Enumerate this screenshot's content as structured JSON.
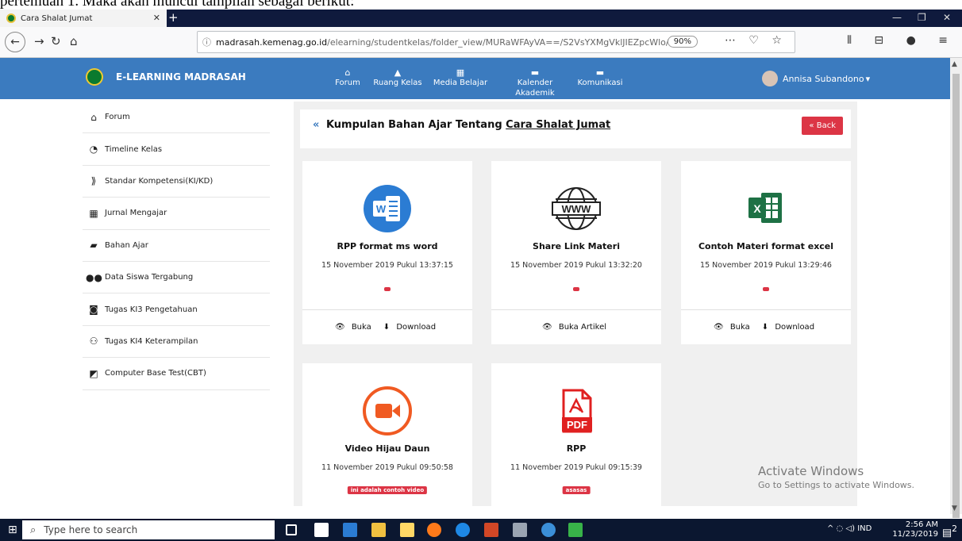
{
  "doc_caption": "pertemuan 1. Maka akan muncul tampilan sebagai berikut:",
  "browser": {
    "tab_title": "Cara Shalat Jumat",
    "url_domain": "madrasah.kemenag.go.id",
    "url_path": "/elearning/studentkelas/folder_view/MURaWFAyVA==/S2VsYXMgVklJIEZpcWlo/",
    "zoom": "90%"
  },
  "app": {
    "brand": "E-LEARNING MADRASAH",
    "nav": [
      {
        "label": "Forum",
        "icon": "home-icon"
      },
      {
        "label": "Ruang Kelas",
        "icon": "class-icon"
      },
      {
        "label": "Media Belajar",
        "icon": "media-icon"
      },
      {
        "label": "Kalender Akademik",
        "icon": "calendar-icon"
      },
      {
        "label": "Komunikasi",
        "icon": "chat-icon"
      }
    ],
    "user": "Annisa Subandono"
  },
  "sidebar": {
    "items": [
      {
        "label": "Forum",
        "icon": "home-icon"
      },
      {
        "label": "Timeline Kelas",
        "icon": "timeline-icon"
      },
      {
        "label": "Standar Kompetensi(KI/KD)",
        "icon": "standard-icon"
      },
      {
        "label": "Jurnal Mengajar",
        "icon": "calendar-icon"
      },
      {
        "label": "Bahan Ajar",
        "icon": "folder-icon"
      },
      {
        "label": "Data Siswa Tergabung",
        "icon": "users-icon"
      },
      {
        "label": "Tugas KI3 Pengetahuan",
        "icon": "task-icon"
      },
      {
        "label": "Tugas KI4 Keterampilan",
        "icon": "skill-icon"
      },
      {
        "label": "Computer Base Test(CBT)",
        "icon": "cbt-icon"
      }
    ]
  },
  "header": {
    "prefix": "Kumpulan Bahan Ajar Tentang",
    "topic": "Cara Shalat Jumat",
    "back": "Back"
  },
  "cards": [
    {
      "title": "RPP format ms word",
      "date": "15 November 2019 Pukul 13:37:15",
      "icon": "word-icon",
      "badge": "",
      "actions": [
        "Buka",
        "Download"
      ]
    },
    {
      "title": "Share Link Materi",
      "date": "15 November 2019 Pukul 13:32:20",
      "icon": "www-icon",
      "badge": "",
      "actions": [
        "Buka Artikel"
      ]
    },
    {
      "title": "Contoh Materi format excel",
      "date": "15 November 2019 Pukul 13:29:46",
      "icon": "excel-icon",
      "badge": "",
      "actions": [
        "Buka",
        "Download"
      ]
    },
    {
      "title": "Video Hijau Daun",
      "date": "11 November 2019 Pukul 09:50:58",
      "icon": "video-icon",
      "badge": "ini adalah contoh video",
      "actions": []
    },
    {
      "title": "RPP",
      "date": "11 November 2019 Pukul 09:15:39",
      "icon": "pdf-icon",
      "badge": "asasas",
      "actions": []
    }
  ],
  "watermark": {
    "line1": "Activate Windows",
    "line2": "Go to Settings to activate Windows."
  },
  "taskbar": {
    "search_placeholder": "Type here to search",
    "time": "2:56 AM",
    "date": "11/23/2019",
    "lang": "IND",
    "notif_count": "2"
  },
  "colors": {
    "primary": "#3b7bbf",
    "danger": "#dc3545",
    "word": "#2b7cd3",
    "excel": "#1e7145",
    "video": "#f05a22",
    "pdf": "#e02020"
  }
}
